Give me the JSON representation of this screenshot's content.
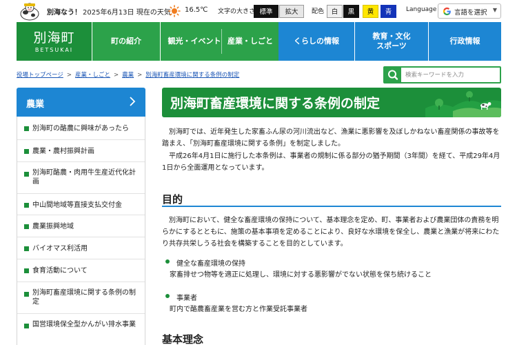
{
  "topbar": {
    "weather_title": "別海なう！",
    "weather_date": "2025年6月13日 現在の天気",
    "temperature": "16.5℃",
    "weather_icon": "sun-icon",
    "font_size_label": "文字の大きさ",
    "font_size_standard": "標準",
    "font_size_large": "拡大",
    "color_label": "配色",
    "color_white": "白",
    "color_black": "黒",
    "color_yellow": "黄",
    "color_blue": "青",
    "language_label": "Language",
    "language_select": "言語を選択"
  },
  "nav": {
    "logo_jp": "別海町",
    "logo_en": "BETSUKAI",
    "items": [
      {
        "label": "町の紹介"
      },
      {
        "label": "観光・イベント"
      },
      {
        "label": "産業・しごと"
      },
      {
        "label": "くらしの情報"
      },
      {
        "label": "教育・文化\nスポーツ"
      },
      {
        "label": "行政情報"
      }
    ]
  },
  "breadcrumb": {
    "items": [
      "役場トップページ",
      "産業・しごと",
      "農業",
      "別海町畜産環境に関する条例の制定"
    ],
    "separator": ">"
  },
  "search": {
    "placeholder": "検索キーワードを入力"
  },
  "sidebar": {
    "title": "農業",
    "items": [
      {
        "label": "別海町の酪農に興味があったら"
      },
      {
        "label": "農業・農村振興計画"
      },
      {
        "label": "別海町酪農・肉用牛生産近代化計画"
      },
      {
        "label": "中山間地域等直接支払交付金"
      },
      {
        "label": "農業振興地域"
      },
      {
        "label": "バイオマス利活用"
      },
      {
        "label": "食育活動について"
      },
      {
        "label": "別海町畜産環境に関する条例の制定"
      },
      {
        "label": "国営環境保全型かんがい排水事業"
      }
    ]
  },
  "main": {
    "title": "別海町畜産環境に関する条例の制定",
    "intro_p1": "別海町では、近年発生した家畜ふん尿の河川流出など、漁業に悪影響を及ぼしかねない畜産関係の事故等を踏まえ、「別海町畜産環境に関する条例」を制定しました。",
    "intro_p2": "平成26年4月1日に施行した本条例は、事業者の規制に係る部分の猶予期間（3年間）を経て、平成29年4月1日から全面運用となっています。",
    "section1_heading": "目的",
    "section1_text": "別海町において、健全な畜産環境の保持について、基本理念を定め、町、事業者および農業団体の責務を明らかにするとともに、施策の基本事項を定めることにより、良好な水環境を保全し、農業と漁業が将来にわたり共存共栄しうる社会を構築することを目的としています。",
    "definitions": [
      {
        "term": "健全な畜産環境の保持",
        "desc": "家畜排せつ物等を適正に処理し、環境に対する悪影響がでない状態を保ち続けること"
      },
      {
        "term": "事業者",
        "desc": "町内で酪農畜産業を営む方と作業受託事業者"
      }
    ],
    "section2_heading": "基本理念"
  },
  "colors": {
    "brand_green": "#1c8f3a",
    "nav_green": "#2ca24a",
    "nav_blue": "#1d86d3",
    "link_blue": "#1a55b5"
  }
}
